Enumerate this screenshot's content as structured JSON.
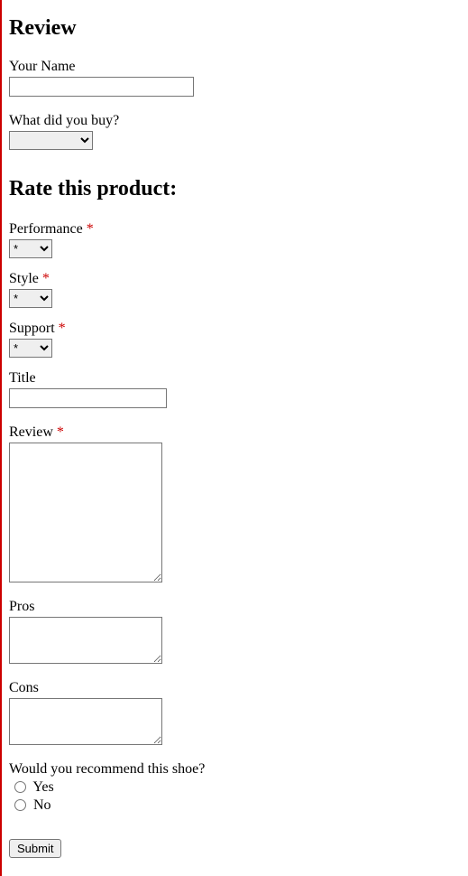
{
  "headings": {
    "main": "Review",
    "rate": "Rate this product:"
  },
  "labels": {
    "name": "Your Name",
    "what": "What did you buy?",
    "performance": "Performance",
    "style": "Style",
    "support": "Support",
    "title": "Title",
    "review": "Review",
    "pros": "Pros",
    "cons": "Cons",
    "recommend": "Would you recommend this shoe?",
    "yes": "Yes",
    "no": "No"
  },
  "required_marker": "*",
  "rating_option": "*",
  "submit": "Submit"
}
